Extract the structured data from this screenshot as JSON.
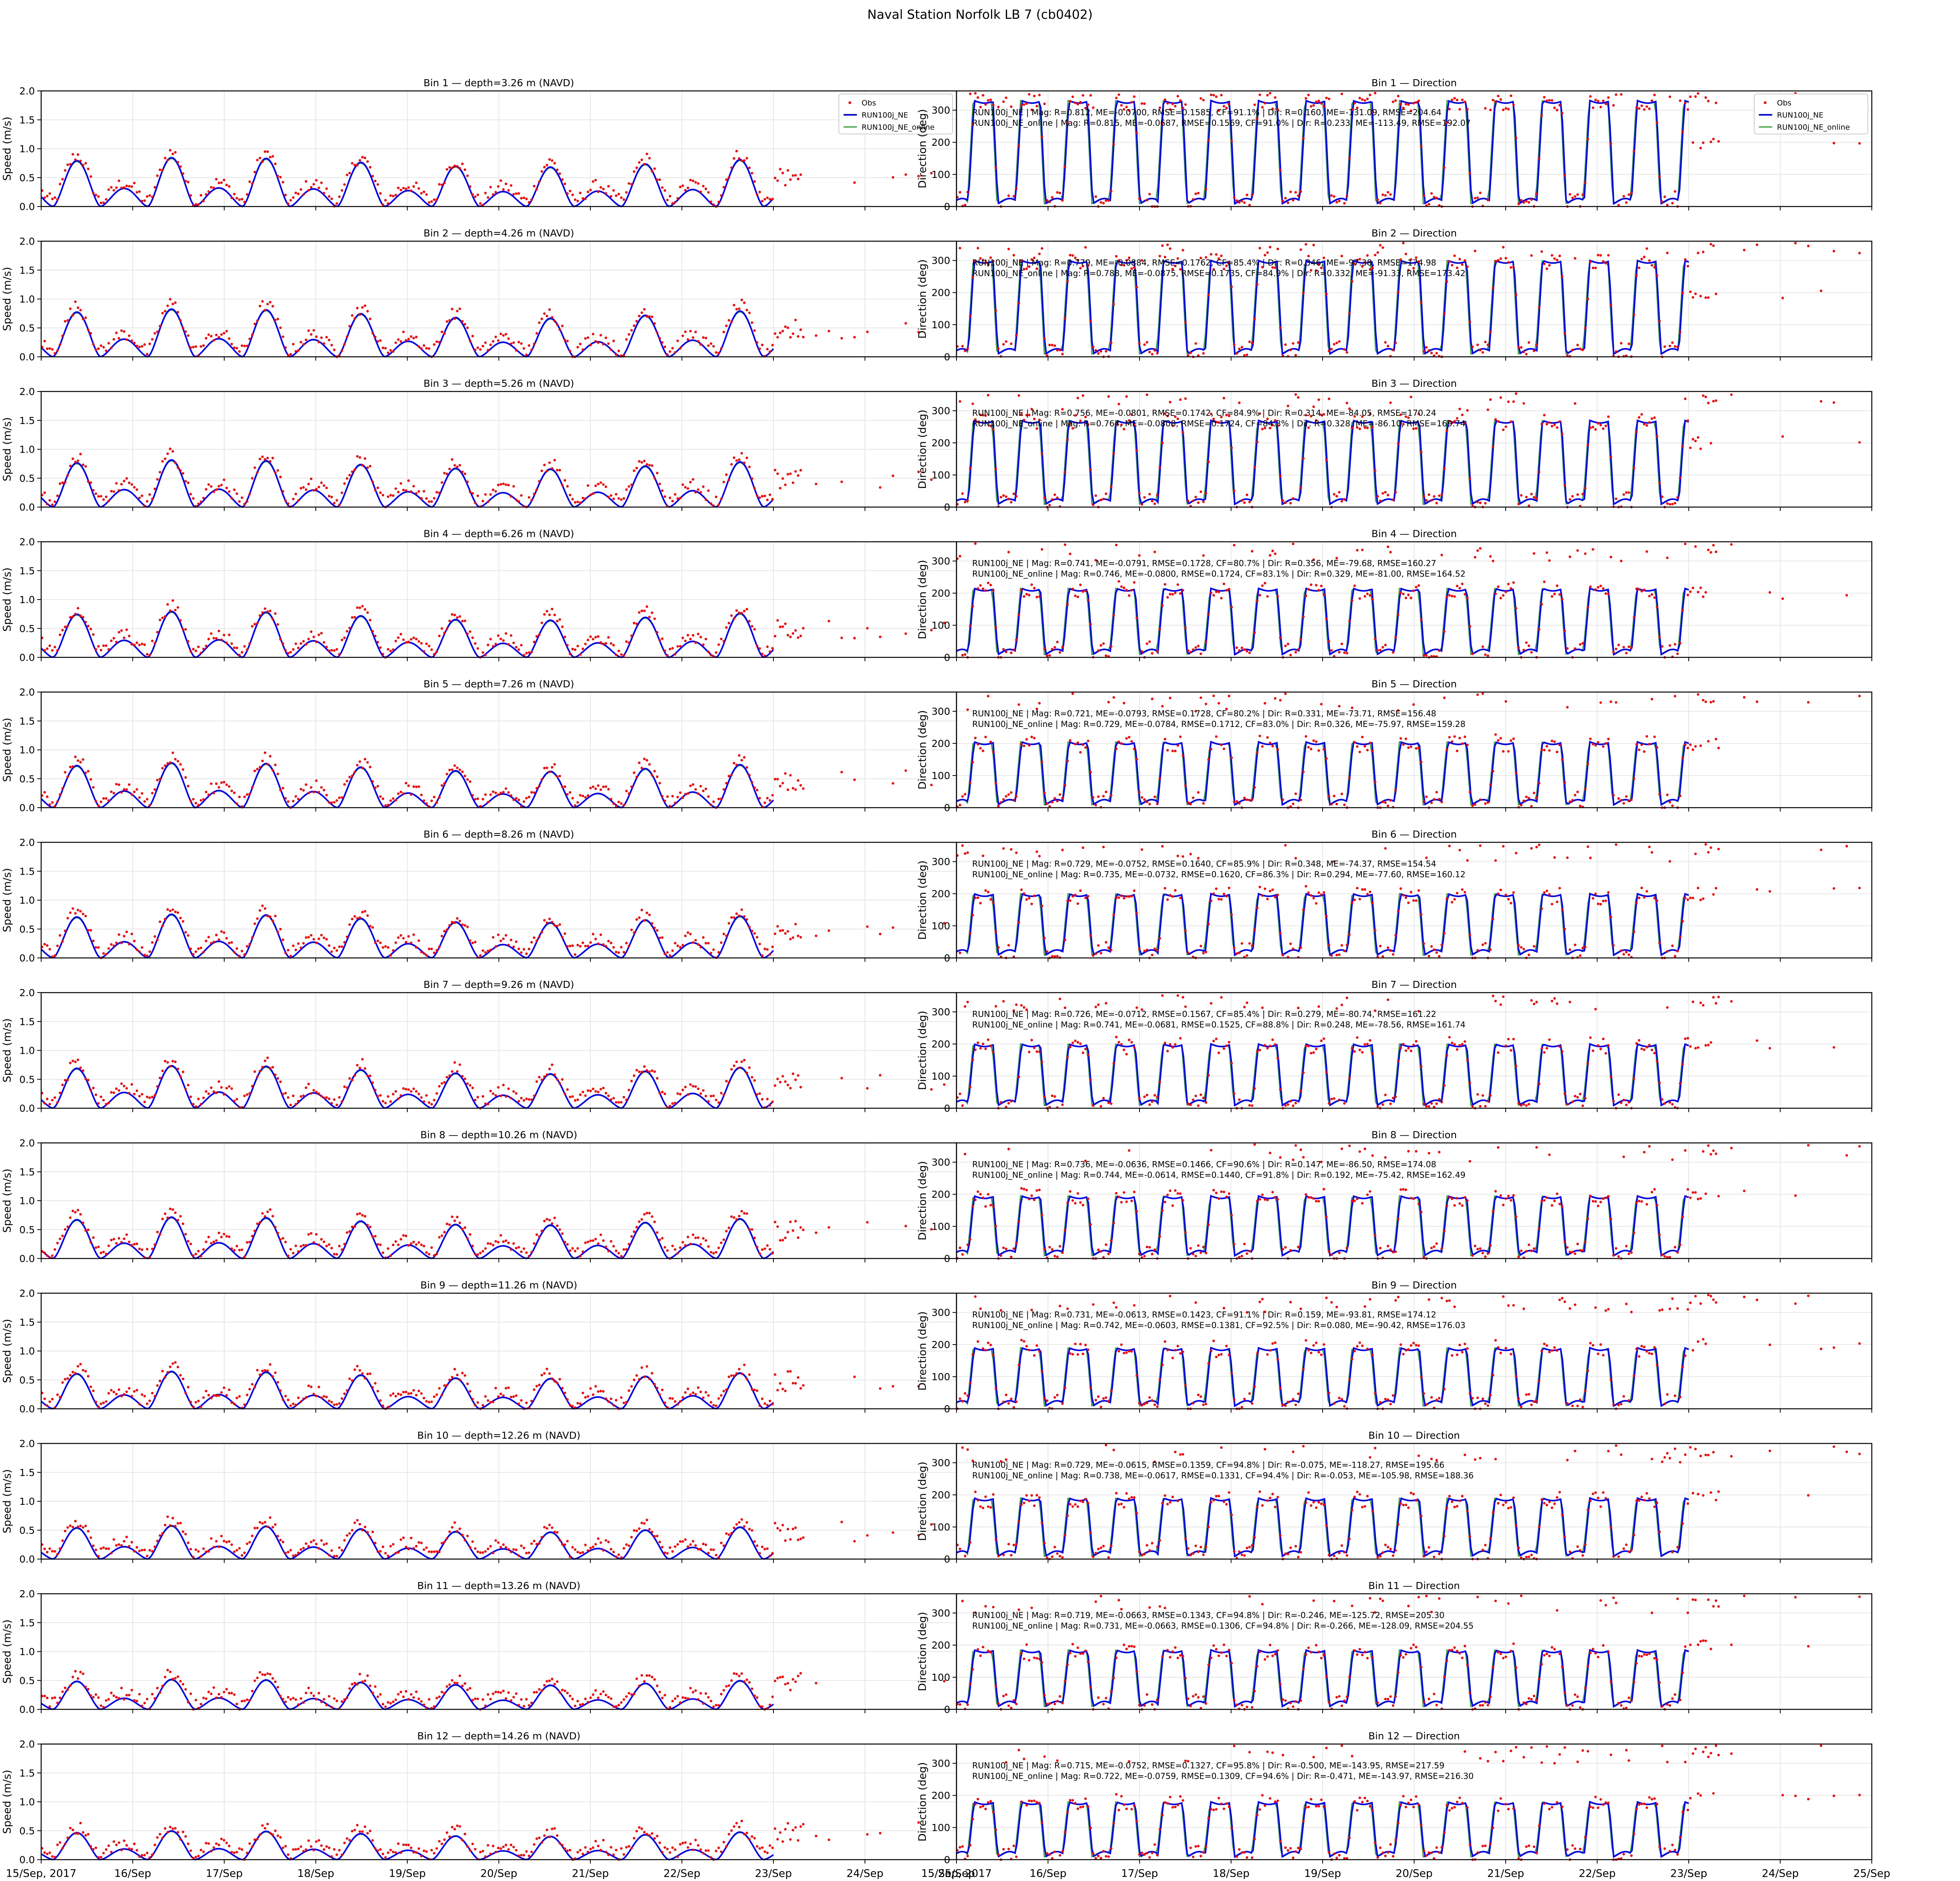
{
  "figure_title": "Naval Station Norfolk LB 7 (cb0402)",
  "legend": {
    "obs": "Obs",
    "model": "RUN100j_NE",
    "model_online": "RUN100j_NE_online"
  },
  "colors": {
    "obs": "#ff0000",
    "model": "#0000ff",
    "model_online": "#2ca02c",
    "axis": "#000000",
    "grid": "#e6e6e6"
  },
  "x_ticks": [
    "15/Sep, 2017",
    "16/Sep",
    "17/Sep",
    "18/Sep",
    "19/Sep",
    "20/Sep",
    "21/Sep",
    "22/Sep",
    "23/Sep",
    "24/Sep",
    "25/Sep"
  ],
  "chart_data": [
    {
      "type": "line",
      "panel": "speed",
      "x_range": [
        "2017-09-15",
        "2017-09-25"
      ],
      "xlabel": "",
      "ylabel": "Speed (m/s)",
      "ylim": [
        0,
        2.0
      ],
      "y_ticks": [
        "0.0",
        "0.5",
        "1.0",
        "1.5",
        "2.0"
      ],
      "grid": true,
      "legend_position": "top-right",
      "obs_end_day": "2017-09-25",
      "model_end_day": "2017-09-23",
      "bins": [
        {
          "title": "Bin 1 — depth=3.26 m (NAVD)",
          "peak_ms": 0.85
        },
        {
          "title": "Bin 2 — depth=4.26 m (NAVD)",
          "peak_ms": 0.83
        },
        {
          "title": "Bin 3 — depth=5.26 m (NAVD)",
          "peak_ms": 0.82
        },
        {
          "title": "Bin 4 — depth=6.26 m (NAVD)",
          "peak_ms": 0.8
        },
        {
          "title": "Bin 5 — depth=7.26 m (NAVD)",
          "peak_ms": 0.78
        },
        {
          "title": "Bin 6 — depth=8.26 m (NAVD)",
          "peak_ms": 0.76
        },
        {
          "title": "Bin 7 — depth=9.26 m (NAVD)",
          "peak_ms": 0.74
        },
        {
          "title": "Bin 8 — depth=10.26 m (NAVD)",
          "peak_ms": 0.72
        },
        {
          "title": "Bin 9 — depth=11.26 m (NAVD)",
          "peak_ms": 0.65
        },
        {
          "title": "Bin 10 — depth=12.26 m (NAVD)",
          "peak_ms": 0.58
        },
        {
          "title": "Bin 11 — depth=13.26 m (NAVD)",
          "peak_ms": 0.52
        },
        {
          "title": "Bin 12 — depth=14.26 m (NAVD)",
          "peak_ms": 0.5
        }
      ]
    },
    {
      "type": "line",
      "panel": "direction",
      "x_range": [
        "2017-09-15",
        "2017-09-25"
      ],
      "xlabel": "",
      "ylabel": "Direction (deg)",
      "ylim": [
        0,
        360
      ],
      "y_ticks": [
        "0",
        "100",
        "200",
        "300"
      ],
      "grid": true,
      "legend_position": "top-right",
      "bins": [
        {
          "title": "Bin 1 — Direction",
          "high_deg": 330,
          "stats": [
            "RUN100j_NE | Mag: R=0.812, ME=-0.0700, RMSE=0.1585, CF=91.1% | Dir: R=0.160, ME=-131.09, RMSE=204.64",
            "RUN100j_NE_online | Mag: R=0.815, ME=-0.0687, RMSE=0.1569, CF=91.0% | Dir: R=0.233, ME=-113.49, RMSE=192.07"
          ]
        },
        {
          "title": "Bin 2 — Direction",
          "high_deg": 300,
          "stats": [
            "RUN100j_NE | Mag: R=0.779, ME=-0.0884, RMSE=0.1762, CF=85.4% | Dir: R=0.346, ME=-97.38, RMSE=174.98",
            "RUN100j_NE_online | Mag: R=0.788, ME=-0.0875, RMSE=0.1735, CF=84.9% | Dir: R=0.332, ME=-91.33, RMSE=173.42"
          ]
        },
        {
          "title": "Bin 3 — Direction",
          "high_deg": 270,
          "stats": [
            "RUN100j_NE | Mag: R=0.756, ME=-0.0801, RMSE=0.1742, CF=84.9% | Dir: R=0.314, ME=-84.05, RMSE=170.24",
            "RUN100j_NE_online | Mag: R=0.764, ME=-0.0808, RMSE=0.1724, CF=84.3% | Dir: R=0.328, ME=-86.10, RMSE=169.74"
          ]
        },
        {
          "title": "Bin 4 — Direction",
          "high_deg": 215,
          "stats": [
            "RUN100j_NE | Mag: R=0.741, ME=-0.0791, RMSE=0.1728, CF=80.7% | Dir: R=0.356, ME=-79.68, RMSE=160.27",
            "RUN100j_NE_online | Mag: R=0.746, ME=-0.0800, RMSE=0.1724, CF=83.1% | Dir: R=0.329, ME=-81.00, RMSE=164.52"
          ]
        },
        {
          "title": "Bin 5 — Direction",
          "high_deg": 205,
          "stats": [
            "RUN100j_NE | Mag: R=0.721, ME=-0.0793, RMSE=0.1728, CF=80.2% | Dir: R=0.331, ME=-73.71, RMSE=156.48",
            "RUN100j_NE_online | Mag: R=0.729, ME=-0.0784, RMSE=0.1712, CF=83.0% | Dir: R=0.326, ME=-75.97, RMSE=159.28"
          ]
        },
        {
          "title": "Bin 6 — Direction",
          "high_deg": 200,
          "stats": [
            "RUN100j_NE | Mag: R=0.729, ME=-0.0752, RMSE=0.1640, CF=85.9% | Dir: R=0.348, ME=-74.37, RMSE=154.54",
            "RUN100j_NE_online | Mag: R=0.735, ME=-0.0732, RMSE=0.1620, CF=86.3% | Dir: R=0.294, ME=-77.60, RMSE=160.12"
          ]
        },
        {
          "title": "Bin 7 — Direction",
          "high_deg": 200,
          "stats": [
            "RUN100j_NE | Mag: R=0.726, ME=-0.0712, RMSE=0.1567, CF=85.4% | Dir: R=0.279, ME=-80.74, RMSE=161.22",
            "RUN100j_NE_online | Mag: R=0.741, ME=-0.0681, RMSE=0.1525, CF=88.8% | Dir: R=0.248, ME=-78.56, RMSE=161.74"
          ]
        },
        {
          "title": "Bin 8 — Direction",
          "high_deg": 195,
          "stats": [
            "RUN100j_NE | Mag: R=0.736, ME=-0.0636, RMSE=0.1466, CF=90.6% | Dir: R=0.147, ME=-86.50, RMSE=174.08",
            "RUN100j_NE_online | Mag: R=0.744, ME=-0.0614, RMSE=0.1440, CF=91.8% | Dir: R=0.192, ME=-75.42, RMSE=162.49"
          ]
        },
        {
          "title": "Bin 9 — Direction",
          "high_deg": 190,
          "stats": [
            "RUN100j_NE | Mag: R=0.731, ME=-0.0613, RMSE=0.1423, CF=91.1% | Dir: R=0.159, ME=-93.81, RMSE=174.12",
            "RUN100j_NE_online | Mag: R=0.742, ME=-0.0603, RMSE=0.1381, CF=92.5% | Dir: R=0.080, ME=-90.42, RMSE=176.03"
          ]
        },
        {
          "title": "Bin 10 — Direction",
          "high_deg": 190,
          "stats": [
            "RUN100j_NE | Mag: R=0.729, ME=-0.0615, RMSE=0.1359, CF=94.8% | Dir: R=-0.075, ME=-118.27, RMSE=195.66",
            "RUN100j_NE_online | Mag: R=0.738, ME=-0.0617, RMSE=0.1331, CF=94.4% | Dir: R=-0.053, ME=-105.98, RMSE=188.36"
          ]
        },
        {
          "title": "Bin 11 — Direction",
          "high_deg": 185,
          "stats": [
            "RUN100j_NE | Mag: R=0.719, ME=-0.0663, RMSE=0.1343, CF=94.8% | Dir: R=-0.246, ME=-125.72, RMSE=205.30",
            "RUN100j_NE_online | Mag: R=0.731, ME=-0.0663, RMSE=0.1306, CF=94.8% | Dir: R=-0.266, ME=-128.09, RMSE=204.55"
          ]
        },
        {
          "title": "Bin 12 — Direction",
          "high_deg": 180,
          "stats": [
            "RUN100j_NE | Mag: R=0.715, ME=-0.0752, RMSE=0.1327, CF=95.8% | Dir: R=-0.500, ME=-143.95, RMSE=217.59",
            "RUN100j_NE_online | Mag: R=0.722, ME=-0.0759, RMSE=0.1309, CF=94.6% | Dir: R=-0.471, ME=-143.97, RMSE=216.30"
          ]
        }
      ]
    }
  ]
}
